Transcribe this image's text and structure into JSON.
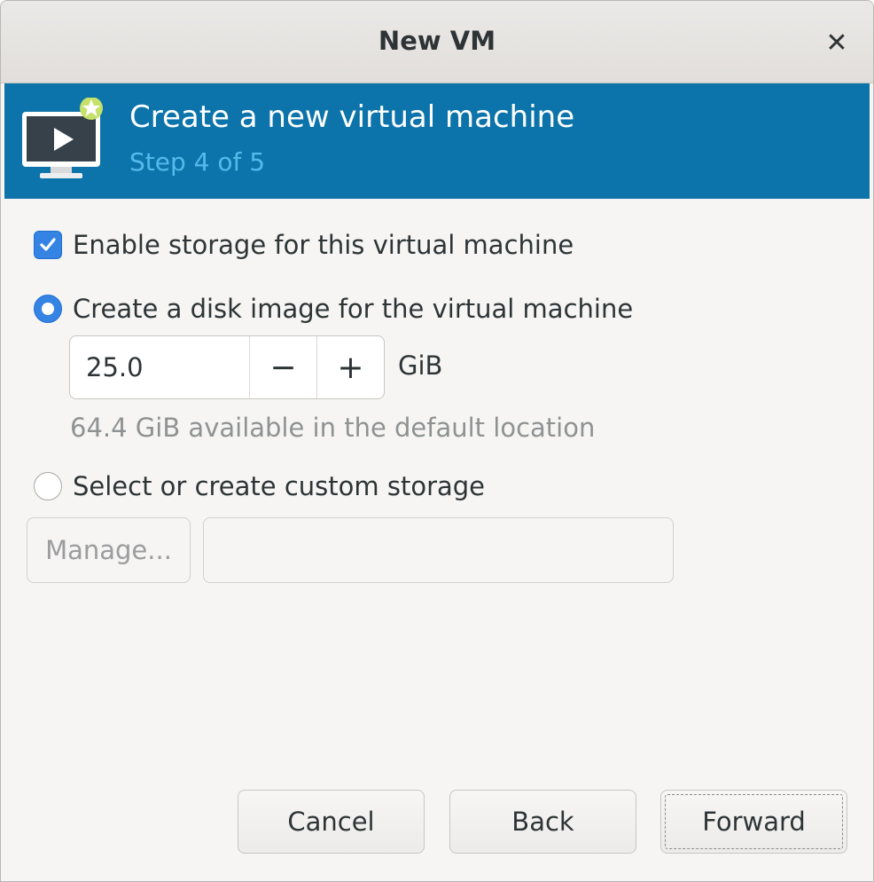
{
  "window": {
    "title": "New VM",
    "close_glyph": "✕"
  },
  "banner": {
    "icon": "vm-monitor-new-icon",
    "title": "Create a new virtual machine",
    "step": "Step 4 of 5"
  },
  "storage": {
    "enable_label": "Enable storage for this virtual machine",
    "enable_checked": true,
    "create_disk_label": "Create a disk image for the virtual machine",
    "create_disk_selected": true,
    "disk_size": "25.0",
    "decrement_glyph": "−",
    "increment_glyph": "+",
    "unit": "GiB",
    "available_hint": "64.4 GiB available in the default location",
    "custom_label": "Select or create custom storage",
    "custom_selected": false,
    "manage_label": "Manage...",
    "custom_path": ""
  },
  "footer": {
    "cancel_label": "Cancel",
    "back_label": "Back",
    "forward_label": "Forward"
  },
  "colors": {
    "banner_bg": "#0c74aa",
    "banner_step": "#56b9ec",
    "accent": "#3584e4"
  }
}
